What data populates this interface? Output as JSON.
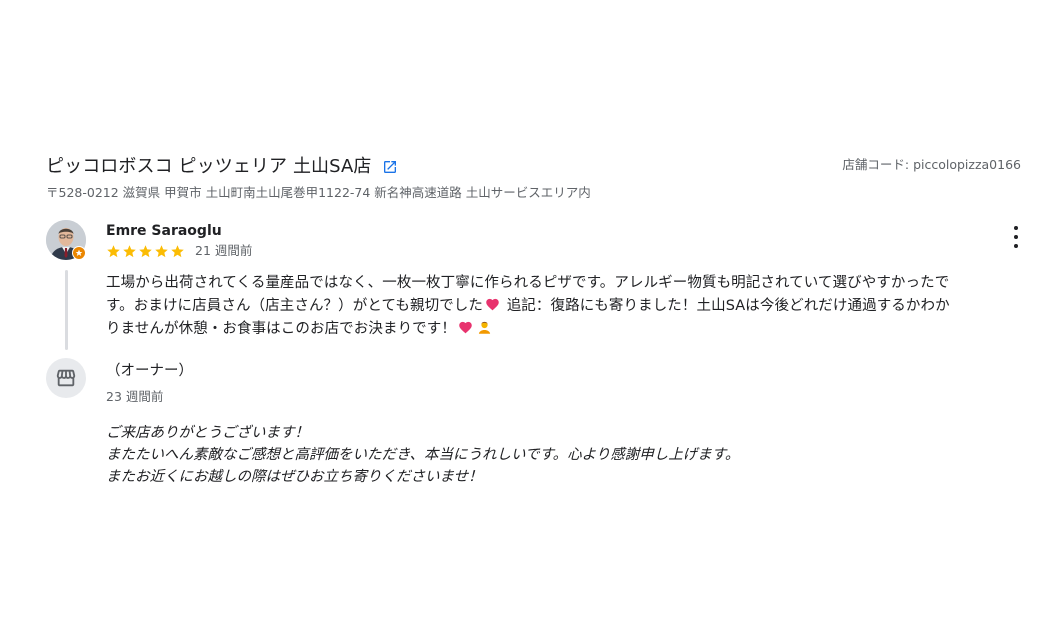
{
  "store": {
    "name": "ピッコロボスコ ピッツェリア 土山SA店",
    "address": "〒528-0212 滋賀県 甲賀市 土山町南土山尾巻甲1122-74 新名神高速道路 土山サービスエリア内",
    "code": "店舗コード: piccolopizza0166",
    "link_icon": "open-in-new-icon"
  },
  "review": {
    "reviewer_name": "Emre Saraoglu",
    "rating": 5,
    "date": "21 週間前",
    "text_part1": "工場から出荷されてくる量産品ではなく、一枚一枚丁寧に作られるピザです。アレルギー物質も明記されていて選びやすかったです。おまけに店員さん（店主さん？）がとても親切でした",
    "text_part2": " 追記：復路にも寄りました！土山SAは今後どれだけ通過するかわかりませんが休憩・お食事はこのお店でお決まりです！",
    "icons": {
      "avatar_badge": "local-guide-star-icon",
      "more": "more-vert-icon",
      "emoji1": "heart-emoji",
      "emoji2": "heart-emoji",
      "emoji3": "bowing-person-emoji"
    },
    "star_color": "#fbbc04"
  },
  "owner_reply": {
    "name": "（オーナー）",
    "date": "23 週間前",
    "lines": [
      "ご来店ありがとうございます！",
      "またたいへん素敵なご感想と高評価をいただき、本当にうれしいです。心より感謝申し上げます。",
      "またお近くにお越しの際はぜひお立ち寄りくださいませ！"
    ],
    "icon": "storefront-icon"
  },
  "colors": {
    "accent_link": "#1a73e8",
    "secondary_text": "#5f6368"
  }
}
